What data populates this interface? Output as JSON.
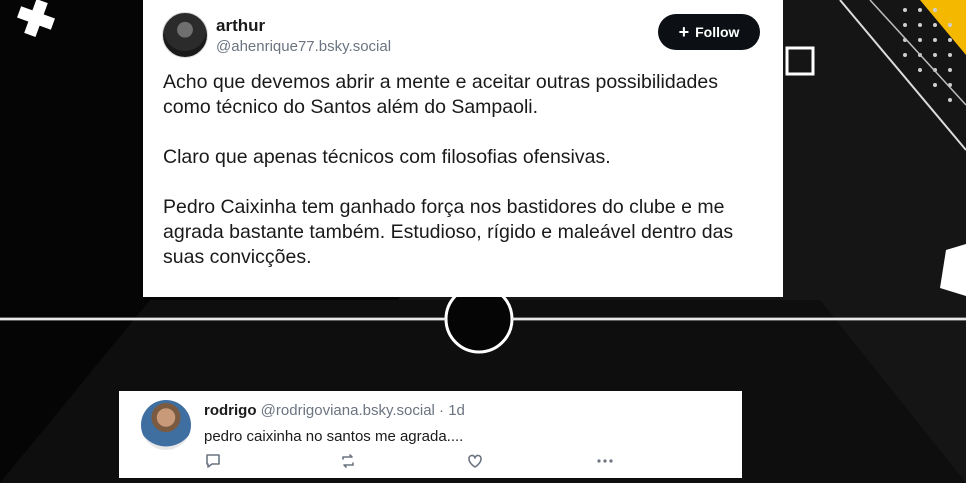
{
  "post": {
    "author_name": "arthur",
    "author_handle": "@ahenrique77.bsky.social",
    "follow_label": "Follow",
    "paragraphs": [
      "Acho que devemos abrir a mente e aceitar outras possibilidades como técnico do Santos além do Sampaoli.",
      "Claro que apenas técnicos com filosofias ofensivas.",
      "Pedro Caixinha tem ganhado força nos bastidores do clube e me agrada bastante também. Estudioso, rígido e maleável dentro das suas convicções."
    ]
  },
  "reply": {
    "author_name": "rodrigo",
    "author_handle": "@rodrigoviana.bsky.social",
    "separator": "·",
    "time": "1d",
    "text": "pedro caixinha no santos me agrada...."
  },
  "icons": {
    "reply": "comment-icon",
    "repost": "repost-icon",
    "like": "heart-icon",
    "more": "more-icon"
  },
  "colors": {
    "background": "#050505",
    "accent": "#f5b800",
    "card": "#ffffff",
    "muted_text": "#6b7480"
  }
}
